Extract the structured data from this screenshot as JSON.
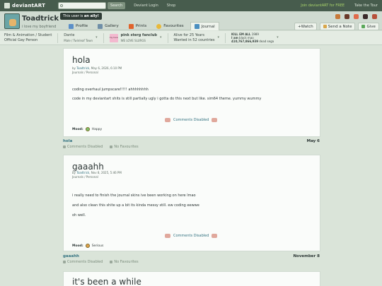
{
  "topbar": {
    "logo": "deviantART",
    "search_placeholder": "",
    "search_label": "Search",
    "login": "Deviant Login",
    "shop": "Shop",
    "join": "Join deviantART for FREE",
    "tour": "Take the Tour"
  },
  "profile": {
    "username": "Toadtrick",
    "tagline": "i love my boyfriend",
    "tooltip_prefix": "This user is",
    "tooltip_emph": "an ally!"
  },
  "nav": {
    "tabs": [
      {
        "label": "Profile",
        "color": "#5b8fc8"
      },
      {
        "label": "Gallery",
        "color": "#6f8fa8"
      },
      {
        "label": "Prints",
        "color": "#e0632b"
      },
      {
        "label": "Favourites",
        "color": "#e8b93a"
      },
      {
        "label": "Journal",
        "color": "#4a8fc0"
      }
    ]
  },
  "actions": {
    "watch": "+Watch",
    "note": "Send a Note",
    "give": "Give"
  },
  "infobar": {
    "category_line1": "Film & Animation / Student",
    "category_line2": "Official Gay Person",
    "name_line1": "Dante",
    "name_line2": "Male / Twinleaf Town",
    "club_name": "pink sterg fanclub",
    "club_sub": "WE LOVE SLURGS",
    "club_icon_text": "my love",
    "alive": "Alive for 25 Years",
    "wanted": "Wanted in 52 countries",
    "stats_line1_bold": "KILL EM ALL",
    "stats_line1": "1989",
    "stats_line2_bold": "I am",
    "stats_line2": "black mao",
    "stats_line3_bold": "410,767,866,939",
    "stats_line3": "dead sega"
  },
  "entries": [
    {
      "title": "hola",
      "by": "by",
      "author": "Toadtrick",
      "date": "May 6, 2026, 6:10 PM",
      "category": "Journals / Personal",
      "lines": [
        "coding overhaul jumpscare!!!!! ahhhhhhhh",
        "code in my deviantart shits is still partially ugly i gotta do this next but like. sim64 theme. yummy wummy"
      ],
      "comments": "Comments Disabled",
      "mood_label": "Mood:",
      "mood": "Happy",
      "foot_title": "hola",
      "foot_date": "May 6",
      "foot_comments": "Comments Disabled",
      "foot_favs": "No Favourites"
    },
    {
      "title": "gaaahh",
      "by": "by",
      "author": "Toadtrick",
      "date": "Nov 8, 2025, 5:46 PM",
      "category": "Journals / Personal",
      "lines": [
        "i really need to finish the journal skins ive been working on here lmao",
        "and also clean this shite up a bit its kinda messy still. ew coding eewwe",
        "oh well."
      ],
      "comments": "Comments Disabled",
      "mood_label": "Mood:",
      "mood": "Serious",
      "foot_title": "gaaahh",
      "foot_date": "November 8",
      "foot_comments": "Comments Disabled",
      "foot_favs": "No Favourites"
    },
    {
      "title": "it's been a while"
    }
  ],
  "colors": {
    "topbar": "#475c4d",
    "link": "#337280",
    "join": "#a9d46b"
  }
}
